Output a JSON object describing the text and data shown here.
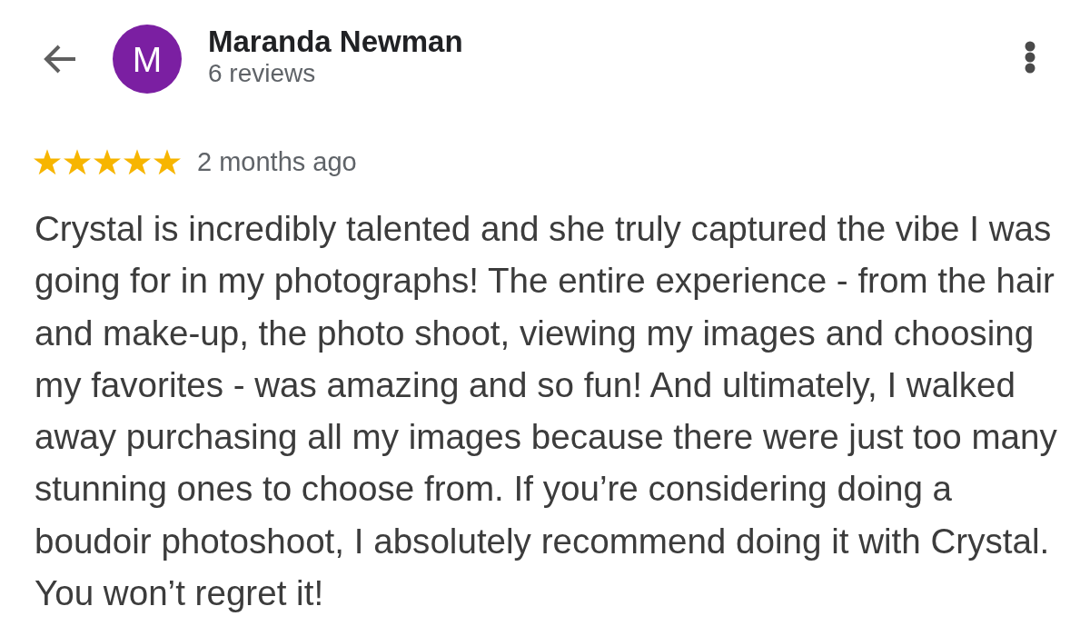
{
  "header": {
    "avatar_letter": "M",
    "name": "Maranda Newman",
    "review_count": "6 reviews"
  },
  "review": {
    "stars": 5,
    "time": "2 months ago",
    "text": "Crystal is incredibly talented and she truly captured the vibe I was going for in my photographs! The entire experience - from the hair and make-up, the photo shoot, viewing my images and choosing my favorites - was amazing and so fun! And ultimately, I walked away purchasing all my images because there were just too many stunning ones to choose from. If you’re considering doing a boudoir photoshoot, I absolutely recommend doing it with Crystal. You won’t regret it!"
  }
}
